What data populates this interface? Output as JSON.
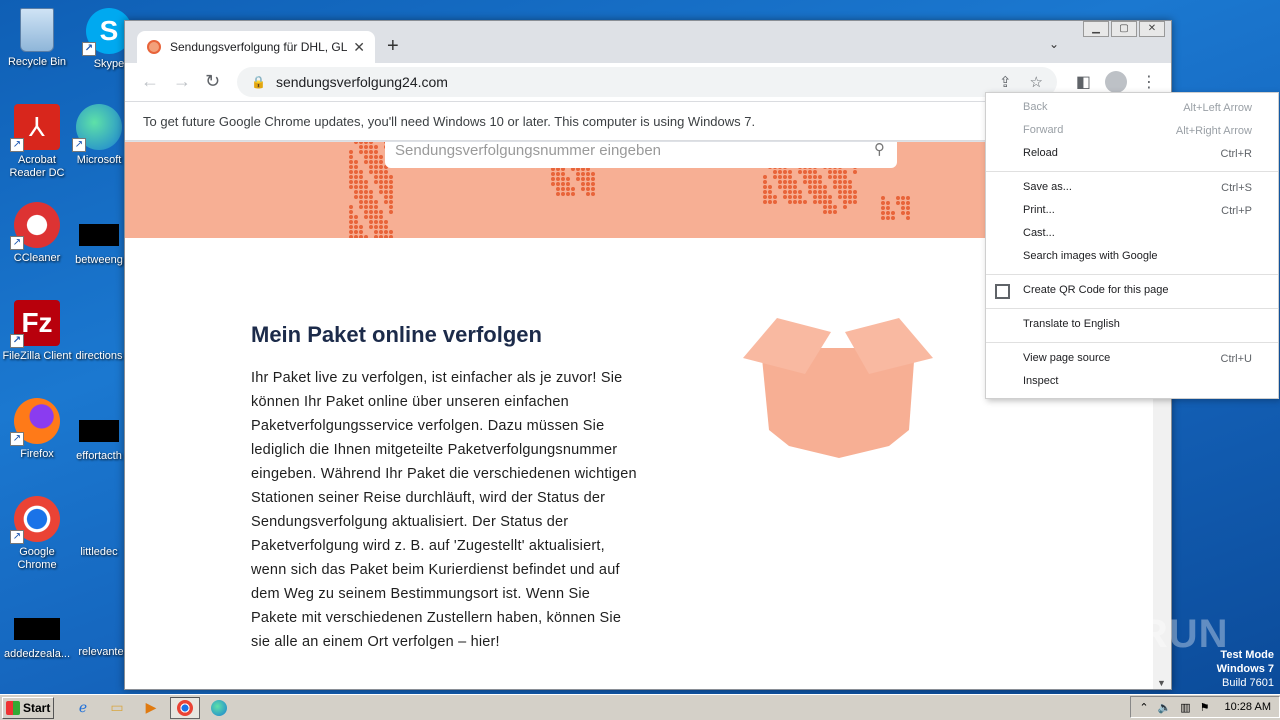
{
  "desktop": {
    "icons": [
      {
        "label": "Recycle Bin"
      },
      {
        "label": "Skype"
      },
      {
        "label": "Acrobat Reader DC"
      },
      {
        "label": "Microsoft"
      },
      {
        "label": "CCleaner"
      },
      {
        "label": "betweeng"
      },
      {
        "label": "FileZilla Client"
      },
      {
        "label": "directions"
      },
      {
        "label": "Firefox"
      },
      {
        "label": "effortacth"
      },
      {
        "label": "Google Chrome"
      },
      {
        "label": "littledec"
      },
      {
        "label": "addedzeala..."
      },
      {
        "label": "relevante"
      }
    ]
  },
  "browser": {
    "tab": {
      "title": "Sendungsverfolgung für DHL, GLS, U",
      "close": "✕"
    },
    "new_tab": "+",
    "url": "sendungsverfolgung24.com",
    "infobar": "To get future Google Chrome updates, you'll need Windows 10 or later. This computer is using Windows 7."
  },
  "page": {
    "input_placeholder": "Sendungsverfolgungsnummer eingeben",
    "heading": "Mein Paket online verfolgen",
    "paragraph": "Ihr Paket live zu verfolgen, ist einfacher als je zuvor! Sie können Ihr Paket online über unseren einfachen Paketverfolgungsservice verfolgen. Dazu müssen Sie lediglich die Ihnen mitgeteilte Paketverfolgungsnummer eingeben. Während Ihr Paket die verschiedenen wichtigen Stationen seiner Reise durchläuft, wird der Status der Sendungsverfolgung aktualisiert. Der Status der Paketverfolgung wird z. B. auf 'Zugestellt' aktualisiert, wenn sich das Paket beim Kurierdienst befindet und auf dem Weg zu seinem Bestimmungsort ist. Wenn Sie Pakete mit verschiedenen Zustellern haben, können Sie sie alle an einem Ort verfolgen – hier!"
  },
  "context_menu": {
    "back": {
      "label": "Back",
      "shortcut": "Alt+Left Arrow"
    },
    "forward": {
      "label": "Forward",
      "shortcut": "Alt+Right Arrow"
    },
    "reload": {
      "label": "Reload",
      "shortcut": "Ctrl+R"
    },
    "save_as": {
      "label": "Save as...",
      "shortcut": "Ctrl+S"
    },
    "print": {
      "label": "Print...",
      "shortcut": "Ctrl+P"
    },
    "cast": {
      "label": "Cast..."
    },
    "search_images": {
      "label": "Search images with Google"
    },
    "qr_code": {
      "label": "Create QR Code for this page"
    },
    "translate": {
      "label": "Translate to English"
    },
    "view_source": {
      "label": "View page source",
      "shortcut": "Ctrl+U"
    },
    "inspect": {
      "label": "Inspect"
    }
  },
  "taskbar": {
    "start": "Start",
    "time": "10:28 AM"
  },
  "overlay": {
    "watermark": "ANY RUN",
    "test_mode": "Test Mode",
    "os": "Windows 7",
    "build": "Build 7601"
  },
  "colors": {
    "hero": "#f7af94",
    "box": "#f7af94",
    "heading": "#1c2b4a",
    "dots": "#e8643a"
  }
}
